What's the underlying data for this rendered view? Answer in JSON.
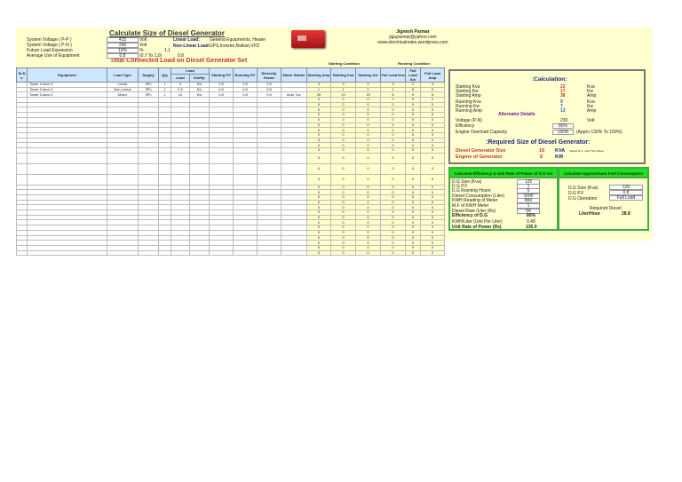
{
  "header": {
    "title": "Calculate Size of Diesel Generator",
    "author": "Jignesh Parmar",
    "email": "jiguparmar@yahoo.com",
    "website": "www.electricalnotes.wordpress.com",
    "subtitle": "Total Connected Load on Diesel Generator Set"
  },
  "params": [
    {
      "label": "System Voltage ( P-P )",
      "value": "415",
      "unit": "Volt"
    },
    {
      "label": "System Voltage ( P-N )",
      "value": "230",
      "unit": "Volt"
    },
    {
      "label": "Future Load Expansion",
      "value": "10%",
      "unit": "%",
      "extra": "1.1"
    },
    {
      "label": "Average Use of Equipment",
      "value": "0.8",
      "unit": "(0.7 To 1.0)",
      "extra": "0.8"
    }
  ],
  "load_types": {
    "linear_label": "Linear Load:",
    "linear_desc": "General Equipments, Heater",
    "nonlinear_label": "Non-Linear Load:",
    "nonlinear_desc": "UPS,Inverter,Ballast,VFD"
  },
  "groups": {
    "starting": "Starting Condition",
    "running": "Running Condition",
    "load": "Load"
  },
  "columns": [
    "Sr.N o",
    "Equipment",
    "Load Type",
    "Supply",
    "Qty",
    "Load",
    "Kw/Hp",
    "Starting P.F",
    "Running P.F",
    "Diversity Factor",
    "Motor Starter",
    "Starting Amp",
    "Starting Kva",
    "Starting Kw",
    "Full Load Kva",
    "Full Load Kw",
    "Full Load Amp"
  ],
  "rows": [
    [
      "",
      "Tower Crane-S",
      "Linear",
      "3Ph",
      "1",
      "4",
      "Kw",
      "0.8",
      "0.8",
      "0.5",
      "",
      "3",
      "3",
      "2",
      "3",
      "2",
      "3"
    ],
    [
      "",
      "Tower Crane-C",
      "Non-Linear",
      "3Ph",
      "1",
      "0.5",
      "Kw",
      "0.8",
      "0.8",
      "0.5",
      "",
      "1",
      "1",
      "0",
      "1",
      "0",
      "0"
    ],
    [
      "",
      "Tower Crane-C",
      "Motor",
      "3Ph",
      "1",
      "10",
      "Kw",
      "0.8",
      "0.8",
      "0.5",
      "Auto Tra.",
      "26",
      "19",
      "15",
      "6",
      "5",
      "8"
    ]
  ],
  "empty_row_values": [
    "0",
    "0",
    "0",
    "0",
    "0",
    "0"
  ],
  "empty_row_count": 28,
  "calculation": {
    "title": ":Calculation:",
    "items": [
      {
        "label": "Starting Kva",
        "value": "22",
        "unit": "Kva"
      },
      {
        "label": "Starting Kw",
        "value": "17",
        "unit": "Kw"
      },
      {
        "label": "Starting Amp",
        "value": "38",
        "unit": "Amp"
      },
      {
        "label": "Running Kva",
        "value": "9",
        "unit": "Kva"
      },
      {
        "label": "Running Kw",
        "value": "7",
        "unit": "Kw"
      },
      {
        "label": "Running Amp",
        "value": "13",
        "unit": "Amp"
      }
    ],
    "alt_title": "Alternator Details",
    "voltage_label": "Voltage (P-N)",
    "voltage": "230",
    "voltage_unit": "Volt",
    "efficiency_label": "Efficiency",
    "efficiency": "80%",
    "overload_label": "Engine Overload Capacity",
    "overload": "130%",
    "overload_note": "(Appro 130% To 150%)",
    "req_title": ":Required Size of Diesel Generator:",
    "dg_size_label": "Diesel Generator Size",
    "dg_size": "19",
    "dg_size_unit": "KVA",
    "dg_note": "(Select D.G. near This Value)",
    "engine_label": "Engine of Generator",
    "engine": "8",
    "engine_unit": "KW"
  },
  "efficiency_box": {
    "title": "Calculate Efficiency & Unit Rate of Power of D.G set",
    "items": [
      {
        "label": "D.G Size (Kva)",
        "value": "125"
      },
      {
        "label": "D.G P.F",
        "value": "1"
      },
      {
        "label": "D.G Running Hours",
        "value": "5"
      },
      {
        "label": "Diesel Consumption (Liter)",
        "value": "1000"
      },
      {
        "label": "KWH Reading of Meter",
        "value": "800"
      },
      {
        "label": "M.F of KWH Meter",
        "value": "1"
      },
      {
        "label": "Diesel Rate /Liter (Rs)",
        "value": "54"
      }
    ],
    "eff_label": "Efficiency of D.G",
    "eff": "80%",
    "kwh_label": "KWH/Liter (Unit Per Liter)",
    "kwh": "0.48",
    "rate_label": "Unit Rate of Power (Rs)",
    "rate": "135.0"
  },
  "fuel_box": {
    "title": "Calculate Approximate Fuel Consumption",
    "size_label": "D.G Size (Kva)",
    "size": "125",
    "pf_label": "D.G P.F",
    "pf": "0.8",
    "op_label": "D.G Operation",
    "op": "Full Load",
    "req_label": "Required Diesel",
    "lph_label": "Liter/Hour",
    "lph": "28.8"
  }
}
